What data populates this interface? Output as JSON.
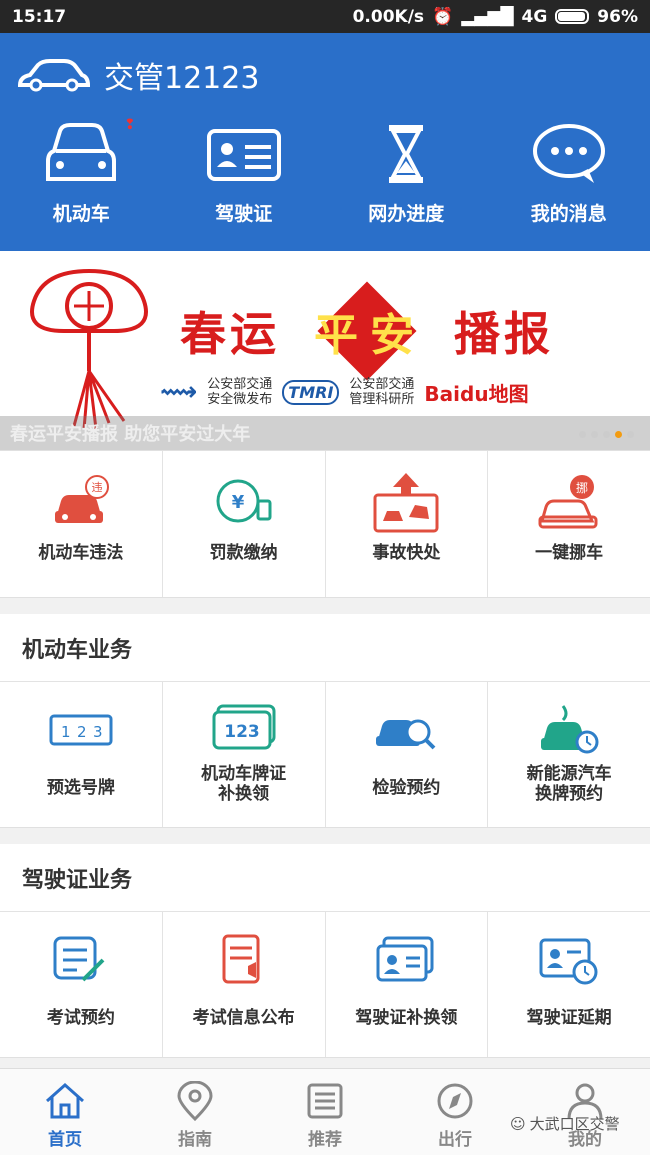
{
  "status_bar": {
    "time": "15:17",
    "network_speed": "0.00K/s",
    "network": "4G",
    "battery": "96%"
  },
  "header": {
    "app_title": "交管12123",
    "quick": [
      {
        "label": "机动车",
        "icon": "car-icon"
      },
      {
        "label": "驾驶证",
        "icon": "license-card-icon"
      },
      {
        "label": "网办进度",
        "icon": "hourglass-icon"
      },
      {
        "label": "我的消息",
        "icon": "chat-bubble-icon"
      }
    ]
  },
  "banner": {
    "title_left": "春运",
    "title_diamond_1": "平",
    "title_diamond_2": "安",
    "title_right": "播报",
    "sponsor_1": "公安部交通\n安全微发布",
    "sponsor_2_logo": "TMRI",
    "sponsor_2": "公安部交通\n管理科研所",
    "sponsor_3": "Baidu地图",
    "caption": "春运平安播报 助您平安过大年",
    "dots_total": 5,
    "dots_active_index": 4
  },
  "services": [
    {
      "label": "机动车违法",
      "icon": "car-violation-icon"
    },
    {
      "label": "罚款缴纳",
      "icon": "fine-payment-icon"
    },
    {
      "label": "事故快处",
      "icon": "accident-icon"
    },
    {
      "label": "一键挪车",
      "icon": "move-car-icon"
    }
  ],
  "vehicle_section": {
    "title": "机动车业务",
    "items": [
      {
        "label": "预选号牌",
        "icon": "plate-select-icon"
      },
      {
        "label": "机动车牌证\n补换领",
        "icon": "plate-123-icon"
      },
      {
        "label": "检验预约",
        "icon": "inspection-icon"
      },
      {
        "label": "新能源汽车\n换牌预约",
        "icon": "ev-plate-icon"
      }
    ]
  },
  "license_section": {
    "title": "驾驶证业务",
    "items": [
      {
        "label": "考试预约",
        "icon": "exam-booking-icon"
      },
      {
        "label": "考试信息公布",
        "icon": "exam-info-icon"
      },
      {
        "label": "驾驶证补换领",
        "icon": "license-replace-icon"
      },
      {
        "label": "驾驶证延期",
        "icon": "license-extend-icon"
      }
    ]
  },
  "tabbar": [
    {
      "label": "首页",
      "icon": "home-icon",
      "active": true
    },
    {
      "label": "指南",
      "icon": "location-pin-icon",
      "active": false
    },
    {
      "label": "推荐",
      "icon": "list-icon",
      "active": false
    },
    {
      "label": "出行",
      "icon": "compass-icon",
      "active": false
    },
    {
      "label": "我的",
      "icon": "user-icon",
      "active": false
    }
  ],
  "watermark": "大武口区交警",
  "colors": {
    "primary": "#2a6fc9",
    "banner_red": "#d81d1d",
    "accent_red": "#e04f3f",
    "accent_teal": "#21a58a",
    "accent_blue": "#2f7fc8"
  }
}
